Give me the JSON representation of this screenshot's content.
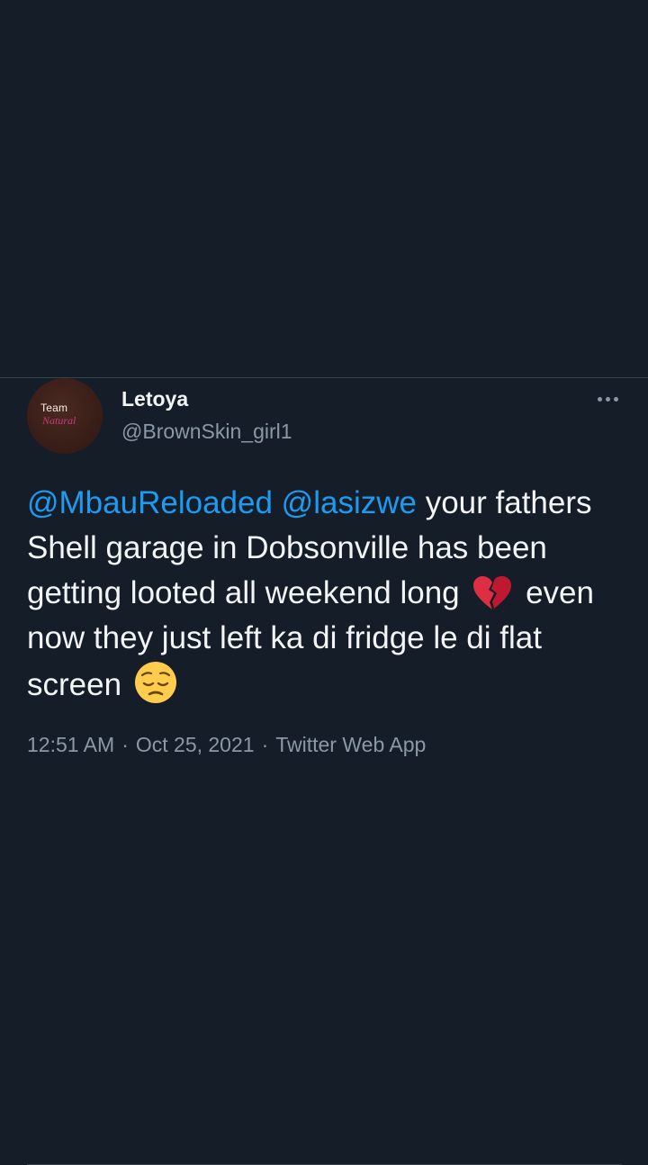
{
  "tweet": {
    "author": {
      "display_name": "Letoya",
      "handle": "@BrownSkin_girl1",
      "avatar_text_line1": "Team",
      "avatar_text_line2": "Natural"
    },
    "body": {
      "mention_1": "@MbauReloaded",
      "mention_2": "@lasizwe",
      "text_part_1": " your fathers Shell garage in Dobsonville has been getting looted all weekend long ",
      "emoji_1": "broken-heart-emoji",
      "text_part_2": " even now they just left ka di fridge le di flat screen ",
      "emoji_2": "pensive-face-emoji"
    },
    "meta": {
      "time": "12:51 AM",
      "separator": "·",
      "date": "Oct 25, 2021",
      "source": "Twitter Web App"
    },
    "more_icon": "more-horizontal-icon"
  },
  "colors": {
    "background": "#151d29",
    "text": "#f2f4f5",
    "secondary_text": "#8b98a5",
    "mention": "#1d9bf0",
    "divider": "#38444d"
  }
}
